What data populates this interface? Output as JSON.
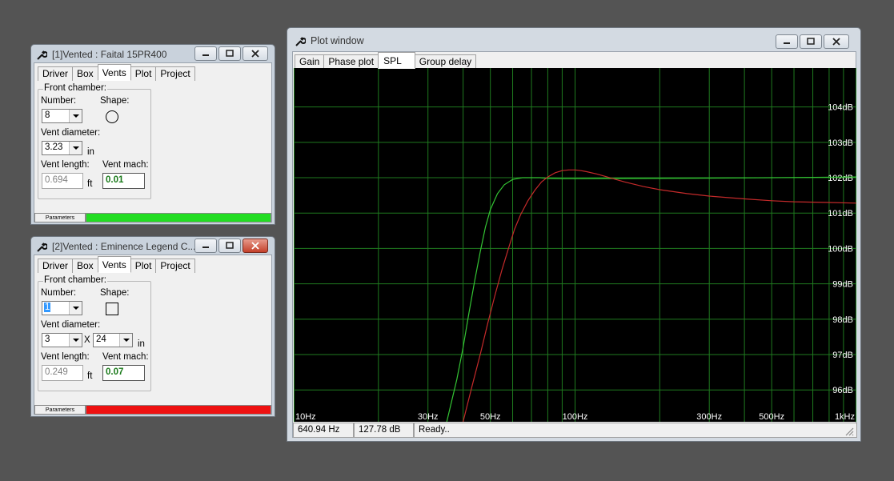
{
  "colors": {
    "desktop": "#545454",
    "plot_bg": "#000000",
    "grid": "#1f7a1f",
    "curve1": "#34c534",
    "curve2": "#c42a2a",
    "axis_text": "#ffffff",
    "param_green": "#22dd22",
    "param_red": "#ee1111",
    "mach_green": "#1a7a1a"
  },
  "window1": {
    "title": "[1]Vented : Faital 15PR400",
    "icon": "wrench-icon",
    "tabs": [
      "Driver",
      "Box",
      "Vents",
      "Plot",
      "Project"
    ],
    "active_tab": "Vents",
    "group_label": "Front chamber:",
    "number_label": "Number:",
    "number_value": "8",
    "shape_label": "Shape:",
    "shape": "circle-icon",
    "vent_diameter_label": "Vent diameter:",
    "vent_diameter_value": "3.23",
    "unit_in": "in",
    "vent_length_label": "Vent length:",
    "vent_length_value": "0.694",
    "unit_ft": "ft",
    "vent_mach_label": "Vent mach:",
    "vent_mach_value": "0.01",
    "parameters_label": "Parameters",
    "parameters_color": "#22dd22"
  },
  "window2": {
    "title": "[2]Vented : Eminence Legend C...",
    "icon": "wrench-icon",
    "tabs": [
      "Driver",
      "Box",
      "Vents",
      "Plot",
      "Project"
    ],
    "active_tab": "Vents",
    "group_label": "Front chamber:",
    "number_label": "Number:",
    "number_value": "1",
    "shape_label": "Shape:",
    "shape": "square-icon",
    "vent_diameter_label": "Vent diameter:",
    "vent_width_value": "3",
    "times": "X",
    "vent_height_value": "24",
    "unit_in": "in",
    "vent_length_label": "Vent length:",
    "vent_length_value": "0.249",
    "unit_ft": "ft",
    "vent_mach_label": "Vent mach:",
    "vent_mach_value": "0.07",
    "parameters_label": "Parameters",
    "parameters_color": "#ee1111"
  },
  "plot_window": {
    "title": "Plot window",
    "icon": "wrench-icon",
    "tabs": [
      "Gain",
      "Phase plot",
      "SPL",
      "Group delay"
    ],
    "active_tab": "SPL",
    "status": {
      "freq": "640.94 Hz",
      "level": "127.78 dB",
      "message": "Ready.."
    }
  },
  "chart_data": {
    "type": "line",
    "xlabel": "",
    "ylabel": "",
    "x_scale": "log",
    "xlim": [
      10,
      1000
    ],
    "ylim": [
      95.1,
      105.1
    ],
    "grid": true,
    "x_ticks": [
      {
        "v": 10,
        "label": "10Hz"
      },
      {
        "v": 30,
        "label": "30Hz"
      },
      {
        "v": 50,
        "label": "50Hz"
      },
      {
        "v": 100,
        "label": "100Hz"
      },
      {
        "v": 300,
        "label": "300Hz"
      },
      {
        "v": 500,
        "label": "500Hz"
      },
      {
        "v": 1000,
        "label": "1kHz"
      }
    ],
    "x_grid": [
      10,
      20,
      30,
      40,
      50,
      60,
      70,
      80,
      90,
      100,
      200,
      300,
      400,
      500,
      600,
      700,
      800,
      900,
      1000
    ],
    "y_ticks": [
      {
        "v": 96,
        "label": "96dB"
      },
      {
        "v": 97,
        "label": "97dB"
      },
      {
        "v": 98,
        "label": "98dB"
      },
      {
        "v": 99,
        "label": "99dB"
      },
      {
        "v": 100,
        "label": "100dB"
      },
      {
        "v": 101,
        "label": "101dB"
      },
      {
        "v": 102,
        "label": "102dB"
      },
      {
        "v": 103,
        "label": "103dB"
      },
      {
        "v": 104,
        "label": "104dB"
      }
    ],
    "series": [
      {
        "color": "#34c534",
        "x": [
          35,
          38,
          40,
          42,
          44,
          46,
          48,
          50,
          53,
          56,
          60,
          65,
          70,
          75,
          80,
          90,
          100,
          200,
          500,
          1000
        ],
        "y": [
          95.1,
          96.3,
          97.2,
          98.2,
          99.1,
          99.9,
          100.6,
          101.1,
          101.55,
          101.8,
          101.95,
          102.0,
          102.0,
          102.0,
          101.98,
          101.97,
          101.97,
          101.98,
          102.0,
          102.02
        ]
      },
      {
        "color": "#c42a2a",
        "x": [
          40,
          43,
          46,
          49,
          52,
          55,
          58,
          61,
          64,
          68,
          72,
          76,
          80,
          85,
          90,
          95,
          100,
          105,
          110,
          120,
          130,
          150,
          175,
          200,
          250,
          300,
          400,
          500,
          600,
          800,
          1000
        ],
        "y": [
          95.1,
          96.1,
          97.0,
          97.9,
          98.7,
          99.4,
          100.0,
          100.55,
          100.95,
          101.35,
          101.65,
          101.88,
          102.02,
          102.14,
          102.2,
          102.22,
          102.22,
          102.2,
          102.17,
          102.1,
          102.02,
          101.88,
          101.75,
          101.66,
          101.55,
          101.48,
          101.4,
          101.35,
          101.32,
          101.3,
          101.28
        ]
      }
    ]
  }
}
